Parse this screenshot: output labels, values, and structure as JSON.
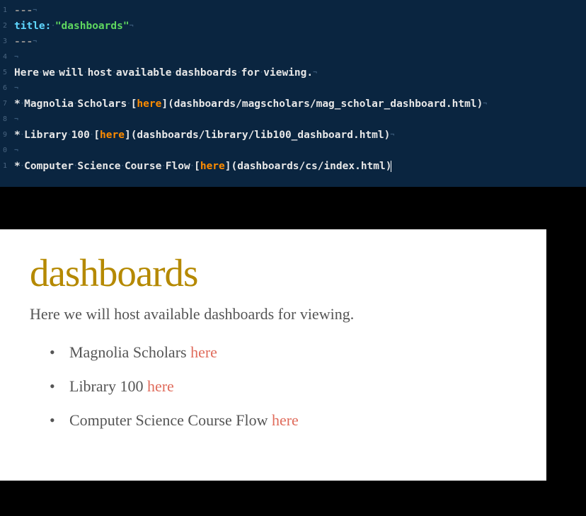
{
  "editor": {
    "lines": [
      {
        "num": "1",
        "type": "dash",
        "text": "---"
      },
      {
        "num": "2",
        "type": "kv",
        "key": "title:",
        "val": "\"dashboards\""
      },
      {
        "num": "3",
        "type": "dash",
        "text": "---"
      },
      {
        "num": "4",
        "type": "blank"
      },
      {
        "num": "5",
        "type": "plain",
        "text": "Here we will host available dashboards for viewing."
      },
      {
        "num": "6",
        "type": "blank"
      },
      {
        "num": "7",
        "type": "bullet",
        "pre": "* Magnolia Scholars ",
        "link": "here",
        "path": "(dashboards/magscholars/mag_scholar_dashboard.html)"
      },
      {
        "num": "8",
        "type": "blank"
      },
      {
        "num": "9",
        "type": "bullet",
        "pre": "* Library 100 ",
        "link": "here",
        "path": "(dashboards/library/lib100_dashboard.html)"
      },
      {
        "num": "0",
        "type": "blank"
      },
      {
        "num": "1",
        "type": "bullet",
        "pre": "* Computer Science Course Flow ",
        "link": "here",
        "path": "(dashboards/cs/index.html)",
        "cursor": true
      }
    ]
  },
  "page": {
    "title": "dashboards",
    "intro": "Here we will host available dashboards for viewing.",
    "items": [
      {
        "label": "Magnolia Scholars ",
        "link": "here"
      },
      {
        "label": "Library 100 ",
        "link": "here"
      },
      {
        "label": "Computer Science Course Flow ",
        "link": "here"
      }
    ]
  }
}
